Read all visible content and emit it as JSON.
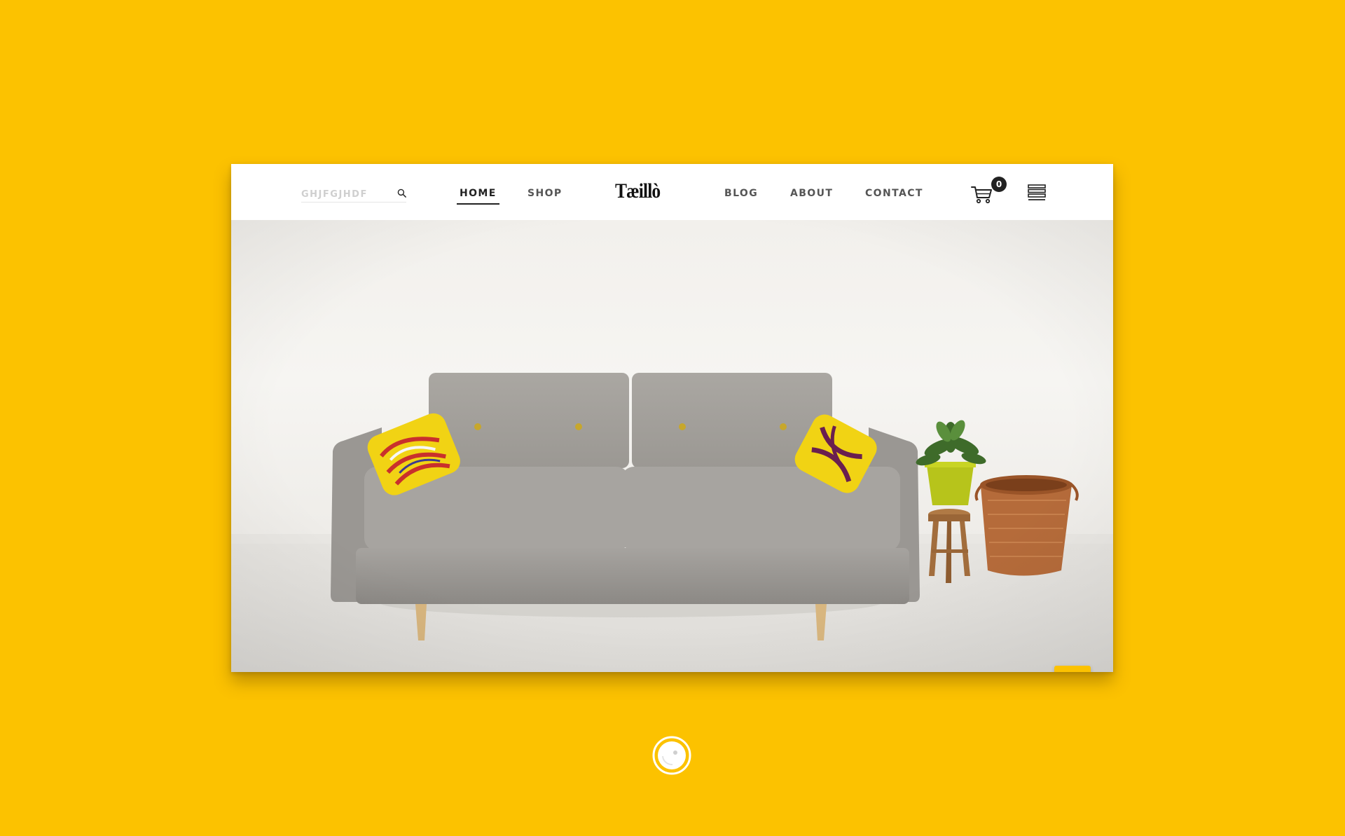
{
  "colors": {
    "background": "#fcc200",
    "accent": "#fcc200",
    "text_dark": "#222222",
    "text_nav": "#555555"
  },
  "search": {
    "value": "GHJFGJHDF",
    "icon": "search-icon"
  },
  "nav": {
    "home": "HOME",
    "shop": "SHOP",
    "blog": "BLOG",
    "about": "ABOUT",
    "contact": "CONTACT",
    "active": "HOME"
  },
  "logo": {
    "text": "Tæillò"
  },
  "cart": {
    "icon": "cart-icon",
    "count": "0"
  },
  "menu": {
    "icon": "hamburger-menu-icon"
  },
  "hero": {
    "image": "gray-sofa-with-yellow-pillows-plant-and-basket"
  },
  "chat": {
    "icon": "chat-bubble-icon"
  },
  "loader": {
    "icon": "loading-spinner-icon"
  }
}
